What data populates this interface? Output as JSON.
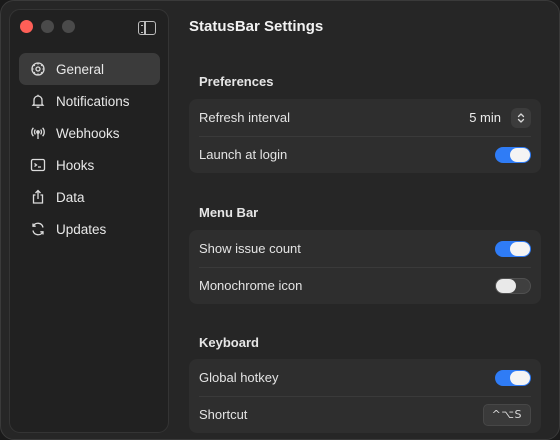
{
  "window": {
    "title": "StatusBar Settings"
  },
  "sidebar": {
    "items": [
      {
        "label": "General",
        "icon": "gear-icon",
        "active": true
      },
      {
        "label": "Notifications",
        "icon": "bell-icon",
        "active": false
      },
      {
        "label": "Webhooks",
        "icon": "antenna-icon",
        "active": false
      },
      {
        "label": "Hooks",
        "icon": "terminal-icon",
        "active": false
      },
      {
        "label": "Data",
        "icon": "share-icon",
        "active": false
      },
      {
        "label": "Updates",
        "icon": "refresh-icon",
        "active": false
      }
    ]
  },
  "sections": {
    "preferences": {
      "title": "Preferences",
      "refresh_label": "Refresh interval",
      "refresh_value": "5 min",
      "launch_label": "Launch at login",
      "launch_on": true
    },
    "menu_bar": {
      "title": "Menu Bar",
      "issue_count_label": "Show issue count",
      "issue_count_on": true,
      "monochrome_label": "Monochrome icon",
      "monochrome_on": false
    },
    "keyboard": {
      "title": "Keyboard",
      "hotkey_label": "Global hotkey",
      "hotkey_on": true,
      "shortcut_label": "Shortcut",
      "shortcut_value": "^⌥S"
    }
  },
  "colors": {
    "accent": "#2f7cf6",
    "close": "#fe5f57"
  }
}
